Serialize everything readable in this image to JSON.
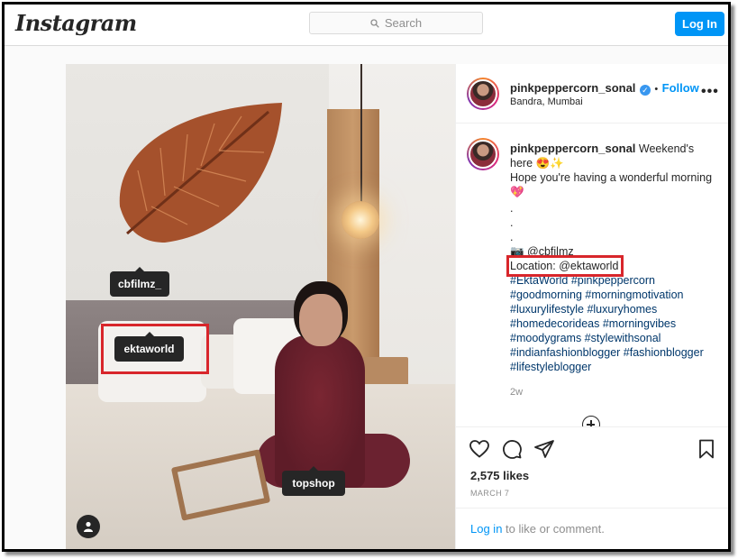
{
  "header": {
    "logo": "Instagram",
    "search_placeholder": "Search",
    "login_button": "Log In"
  },
  "photo": {
    "tags": [
      "cbfilmz_",
      "ektaworld",
      "topshop"
    ],
    "highlighted_tag": "ektaworld"
  },
  "post": {
    "username": "pinkpeppercorn_sonal",
    "follow_label": "Follow",
    "separator": "•",
    "location": "Bandra, Mumbai",
    "more_icon": "•••"
  },
  "caption": {
    "username": "pinkpeppercorn_sonal",
    "line1": "Weekend's here 😍✨",
    "line2": "Hope you're having a wonderful morning 💖",
    "dots": [
      ".",
      ".",
      "."
    ],
    "credit": "📷 @cbfilmz",
    "location_line": "Location: @ektaworld",
    "hashtags": "#EktaWorld #pinkpeppercorn #goodmorning #morningmotivation #luxurylifestyle #luxuryhomes #homedecorideas #morningvibes #moodygrams #stylewithsonal #indianfashionblogger #fashionblogger #lifestyleblogger",
    "time_ago": "2w"
  },
  "engagement": {
    "likes": "2,575 likes",
    "date": "MARCH 7"
  },
  "comment": {
    "login_link": "Log in",
    "rest": " to like or comment."
  },
  "colors": {
    "accent": "#0095f6",
    "highlight": "#d8262b",
    "tag_bg": "#262626"
  }
}
